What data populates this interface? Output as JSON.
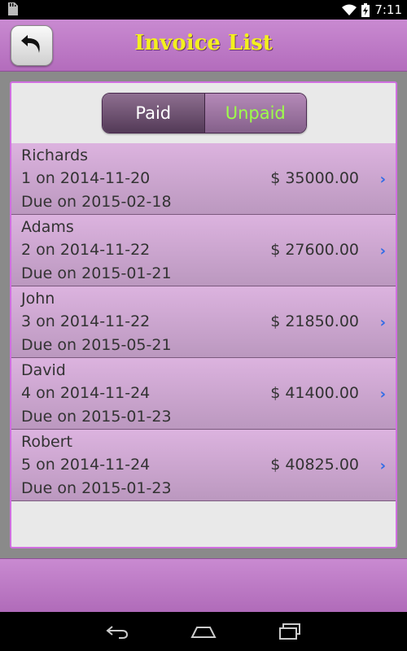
{
  "status_bar": {
    "time": "7:11",
    "icons": [
      "sd-card-icon",
      "wifi-icon",
      "battery-charging-icon"
    ]
  },
  "header": {
    "title": "Invoice List",
    "back_icon": "back-arrow-icon"
  },
  "segmented": {
    "paid_label": "Paid",
    "unpaid_label": "Unpaid",
    "selected": "Unpaid"
  },
  "invoices": [
    {
      "name": "Richards",
      "line": "1 on 2014-11-20",
      "amount": "$ 35000.00",
      "due": "Due on 2015-02-18"
    },
    {
      "name": "Adams",
      "line": "2 on 2014-11-22",
      "amount": "$ 27600.00",
      "due": "Due on 2015-01-21"
    },
    {
      "name": "John",
      "line": "3 on 2014-11-22",
      "amount": "$ 21850.00",
      "due": "Due on 2015-05-21"
    },
    {
      "name": "David",
      "line": "4 on 2014-11-24",
      "amount": "$ 41400.00",
      "due": "Due on 2015-01-23"
    },
    {
      "name": "Robert",
      "line": "5 on 2014-11-24",
      "amount": "$ 40825.00",
      "due": "Due on 2015-01-23"
    }
  ],
  "chevron": "›",
  "nav_bar": {
    "icons": [
      "nav-back-icon",
      "nav-home-icon",
      "nav-recents-icon"
    ]
  },
  "colors": {
    "header": "#c98ad1",
    "title": "#f3f01e",
    "unpaid_text": "#9dff4a",
    "chevron": "#2f6be6"
  }
}
